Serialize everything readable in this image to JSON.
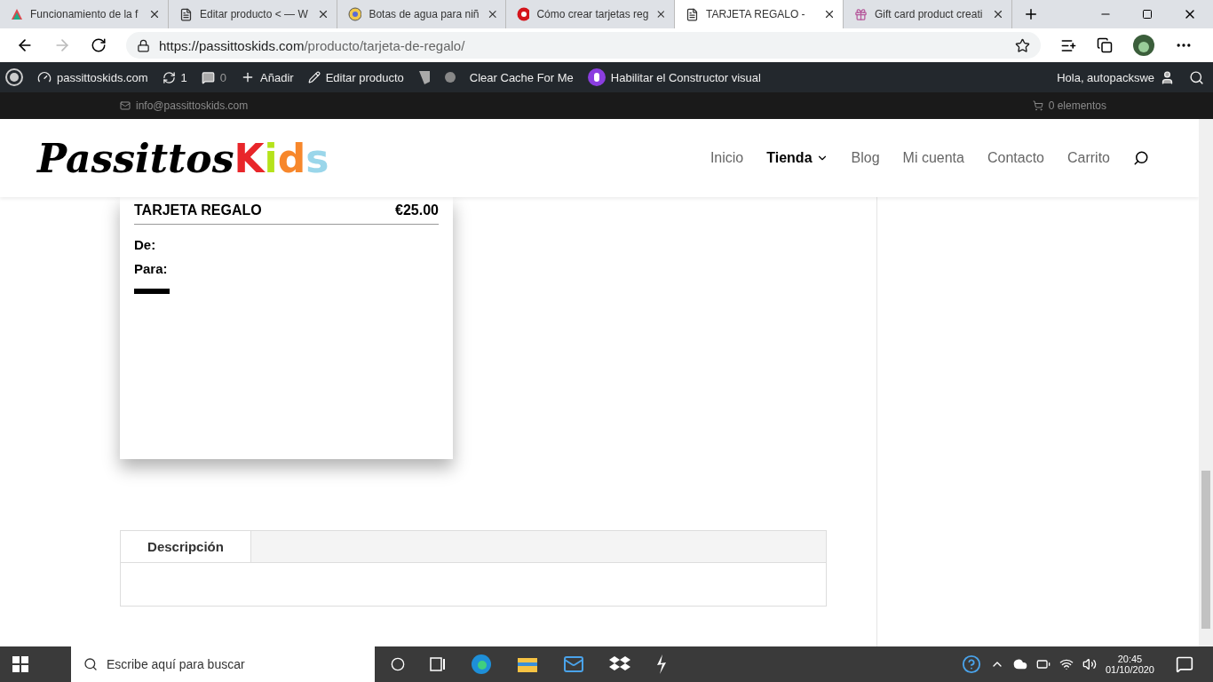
{
  "browser_tabs": [
    {
      "title": "Funcionamiento de la f",
      "selected": false
    },
    {
      "title": "Editar producto < — W",
      "selected": false
    },
    {
      "title": "Botas de agua para niñ",
      "selected": false
    },
    {
      "title": "Cómo crear tarjetas reg",
      "selected": false
    },
    {
      "title": "TARJETA REGALO -",
      "selected": true
    },
    {
      "title": "Gift card product creati",
      "selected": false
    }
  ],
  "address": {
    "domain": "https://passittoskids.com",
    "path": "/producto/tarjeta-de-regalo/"
  },
  "admin_bar": {
    "site": "passittoskids.com",
    "updates": "1",
    "comments": "0",
    "add": "Añadir",
    "edit": "Editar producto",
    "cache": "Clear Cache For Me",
    "builder": "Habilitar el Constructor visual",
    "greeting": "Hola, autopackswe"
  },
  "top_bar": {
    "email": "info@passittoskids.com",
    "cart": "0 elementos"
  },
  "logo": {
    "text": "Passittos",
    "letters": [
      {
        "char": "K",
        "color": "#e8262a"
      },
      {
        "char": "i",
        "color": "#b5e31b"
      },
      {
        "char": "d",
        "color": "#f7872b"
      },
      {
        "char": "s",
        "color": "#9ad6ea"
      }
    ]
  },
  "nav": [
    {
      "label": "Inicio",
      "selected": false,
      "dropdown": false
    },
    {
      "label": "Tienda",
      "selected": true,
      "dropdown": true
    },
    {
      "label": "Blog",
      "selected": false,
      "dropdown": false
    },
    {
      "label": "Mi cuenta",
      "selected": false,
      "dropdown": false
    },
    {
      "label": "Contacto",
      "selected": false,
      "dropdown": false
    },
    {
      "label": "Carrito",
      "selected": false,
      "dropdown": false
    }
  ],
  "card": {
    "title": "TARJETA REGALO",
    "price": "€25.00",
    "from": "De:",
    "to": "Para:"
  },
  "product_tabs": [
    {
      "label": "Descripción",
      "selected": true
    }
  ],
  "taskbar": {
    "search": "Escribe aquí para buscar",
    "time": "20:45",
    "date": "01/10/2020"
  }
}
